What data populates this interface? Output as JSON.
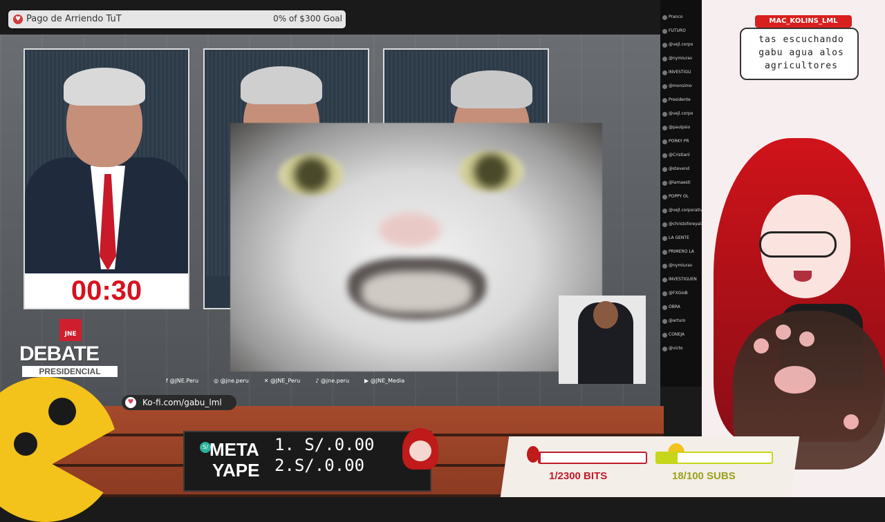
{
  "goal": {
    "title": "Pago de Arriendo TuT",
    "amount": "0% of $300 Goal"
  },
  "debate": {
    "timer": "00:30",
    "jne_logo": "JNE",
    "title": "DEBATE",
    "subtitle": "PRESIDENCIAL",
    "socials": [
      "@JNE.Peru",
      "@jne.peru",
      "@JNE_Peru",
      "@jne.peru",
      "@JNE_Media"
    ]
  },
  "kofi": {
    "text": "Ko-fi.com/gabu_lml"
  },
  "meta_yape": {
    "logo_line1": "META",
    "logo_line2": "YAPE",
    "line1": "1. S/.0.00",
    "line2": "2.S/.0.00"
  },
  "goals_panel": {
    "bits_label": "1/2300 BITS",
    "subs_label": "18/100 SUBS",
    "bits_progress": 0.0004,
    "subs_progress": 0.18,
    "bits_color": "#c01a2a",
    "subs_color": "#c6d61a"
  },
  "chat_bubble": {
    "username": "MAC_KOLINS_LML",
    "message": "tas escuchando gabu agua alos agricultores"
  },
  "chat": {
    "lines": [
      "Pranco",
      "FUTURO",
      "@vejl.corpo",
      "@nymiurav",
      "INVESTIGU",
      "@monsimo",
      "Presidente",
      "@vejl.corpo",
      "@paulpsio",
      "PORKY PR",
      "@Cristianl",
      "@stevend",
      "@lamaesti",
      "POPPY OL",
      "@vejl.corporative",
      "@christoforeyalaab",
      "LA GENTE",
      "PRIMERO LA",
      "@nymiurav",
      "INVESTIGUEN",
      "@FXGioB",
      "OBRA",
      "@arturo",
      "CONEJA",
      "@victo"
    ]
  },
  "colors": {
    "accent_red": "#d7111f",
    "pacman_yellow": "#f3c21b"
  },
  "icons": [
    "heart-icon",
    "facebook-icon",
    "instagram-icon",
    "x-icon",
    "tiktok-icon",
    "youtube-icon",
    "kofi-cup-icon",
    "yape-badge-icon"
  ]
}
